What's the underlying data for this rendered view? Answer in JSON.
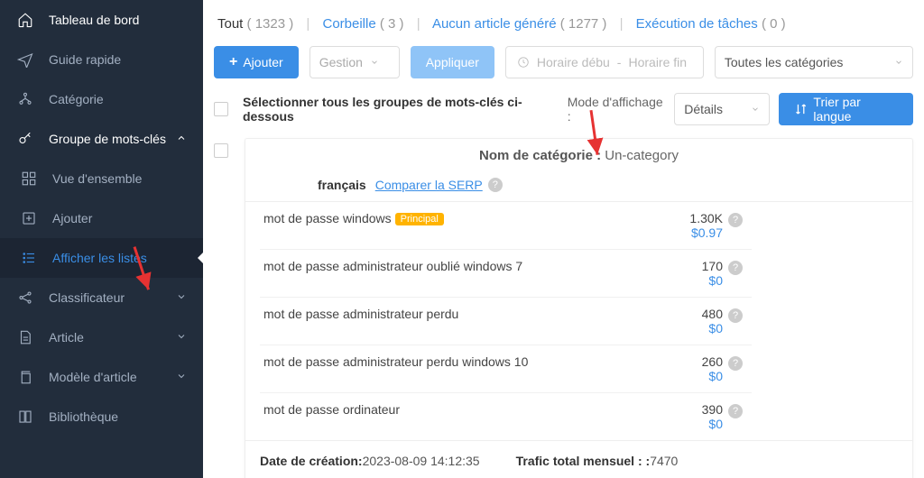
{
  "sidebar": {
    "dashboard": "Tableau de bord",
    "guide": "Guide rapide",
    "category": "Catégorie",
    "kwgroup": "Groupe de mots-clés",
    "overview": "Vue d'ensemble",
    "add": "Ajouter",
    "showlists": "Afficher les listes",
    "classifier": "Classificateur",
    "article": "Article",
    "template": "Modèle d'article",
    "library": "Bibliothèque"
  },
  "tabs": {
    "all_label": "Tout",
    "all_count": "( 1323 )",
    "trash_label": "Corbeille",
    "trash_count": "( 3 )",
    "none_label": "Aucun article généré",
    "none_count": "( 1277 )",
    "exec_label": "Exécution de tâches",
    "exec_count": "( 0 )"
  },
  "toolbar": {
    "add": "Ajouter",
    "manage": "Gestion",
    "apply": "Appliquer",
    "date_start": "Horaire débu",
    "date_sep": "-",
    "date_end": "Horaire fin",
    "all_cat": "Toutes les catégories"
  },
  "filter": {
    "select_all": "Sélectionner tous les groupes de mots-clés ci-dessous",
    "mode_label": "Mode d'affichage :",
    "mode_value": "Détails",
    "sort": "Trier par langue"
  },
  "card": {
    "cat_label": "Nom de catégorie : ",
    "cat_value": "Un-category",
    "lang": "français",
    "compare": "Comparer la SERP",
    "keywords": [
      {
        "name": "mot de passe windows",
        "badge": "Principal",
        "vol": "1.30K",
        "price": "$0.97"
      },
      {
        "name": "mot de passe administrateur oublié windows 7",
        "badge": "",
        "vol": "170",
        "price": "$0"
      },
      {
        "name": "mot de passe administrateur perdu",
        "badge": "",
        "vol": "480",
        "price": "$0"
      },
      {
        "name": "mot de passe administrateur perdu windows 10",
        "badge": "",
        "vol": "260",
        "price": "$0"
      },
      {
        "name": "mot de passe ordinateur",
        "badge": "",
        "vol": "390",
        "price": "$0"
      }
    ],
    "created_label": "Date de création:",
    "created_value": "2023-08-09 14:12:35",
    "traffic_label": "Trafic total mensuel : :",
    "traffic_value": "7470"
  }
}
